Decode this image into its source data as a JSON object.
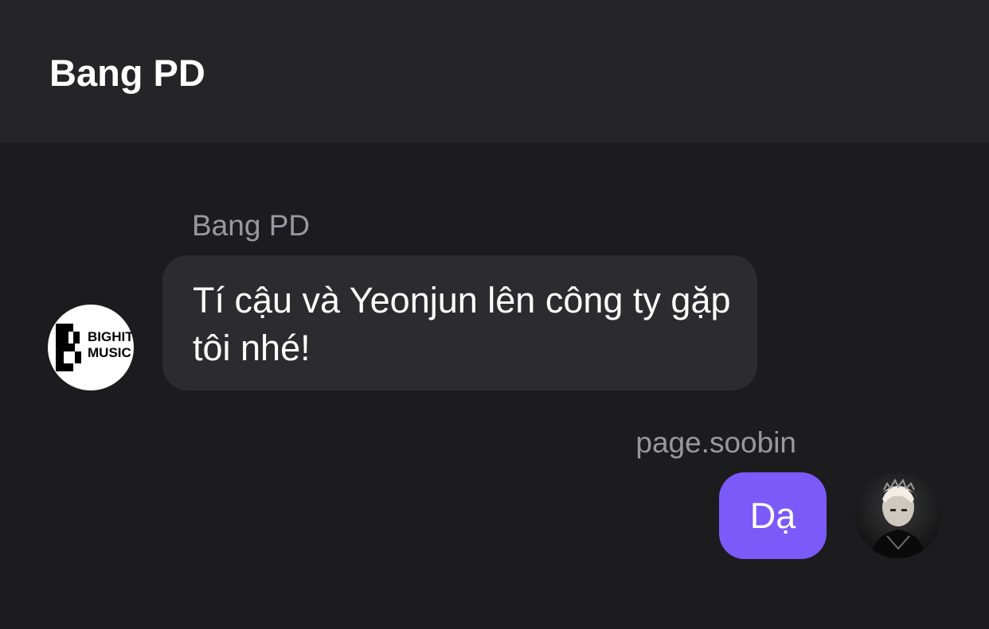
{
  "header": {
    "title": "Bang PD"
  },
  "messages": [
    {
      "direction": "incoming",
      "sender": "Bang PD",
      "avatar": {
        "icon": "bighit-music-logo",
        "logo_text_1": "BIGHIT",
        "logo_text_2": "MUSIC"
      },
      "text": "Tí cậu và Yeonjun lên công ty gặp tôi nhé!"
    },
    {
      "direction": "outgoing",
      "sender": "page.soobin",
      "avatar": {
        "icon": "profile-photo"
      },
      "text": "Dạ"
    }
  ],
  "colors": {
    "background": "#1c1c1e",
    "header_background": "#252527",
    "incoming_bubble": "#2c2c2e",
    "outgoing_bubble": "#7a5af8",
    "sender_name": "#98989f",
    "text": "#ffffff"
  }
}
